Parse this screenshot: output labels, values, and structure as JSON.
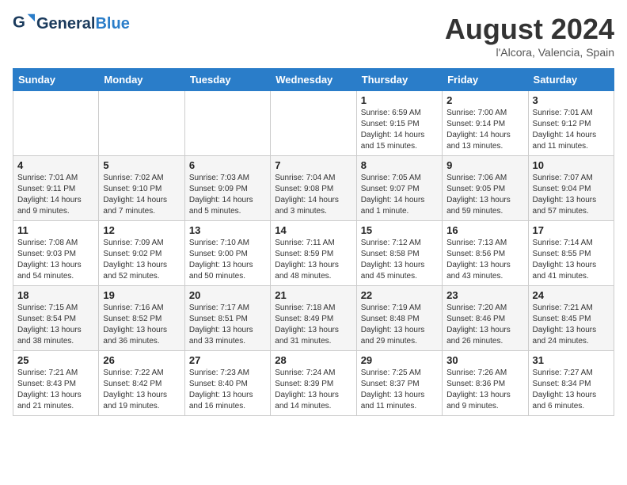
{
  "header": {
    "logo_general": "General",
    "logo_blue": "Blue",
    "month_title": "August 2024",
    "subtitle": "l'Alcora, Valencia, Spain"
  },
  "weekdays": [
    "Sunday",
    "Monday",
    "Tuesday",
    "Wednesday",
    "Thursday",
    "Friday",
    "Saturday"
  ],
  "weeks": [
    [
      {
        "day": "",
        "info": ""
      },
      {
        "day": "",
        "info": ""
      },
      {
        "day": "",
        "info": ""
      },
      {
        "day": "",
        "info": ""
      },
      {
        "day": "1",
        "info": "Sunrise: 6:59 AM\nSunset: 9:15 PM\nDaylight: 14 hours\nand 15 minutes."
      },
      {
        "day": "2",
        "info": "Sunrise: 7:00 AM\nSunset: 9:14 PM\nDaylight: 14 hours\nand 13 minutes."
      },
      {
        "day": "3",
        "info": "Sunrise: 7:01 AM\nSunset: 9:12 PM\nDaylight: 14 hours\nand 11 minutes."
      }
    ],
    [
      {
        "day": "4",
        "info": "Sunrise: 7:01 AM\nSunset: 9:11 PM\nDaylight: 14 hours\nand 9 minutes."
      },
      {
        "day": "5",
        "info": "Sunrise: 7:02 AM\nSunset: 9:10 PM\nDaylight: 14 hours\nand 7 minutes."
      },
      {
        "day": "6",
        "info": "Sunrise: 7:03 AM\nSunset: 9:09 PM\nDaylight: 14 hours\nand 5 minutes."
      },
      {
        "day": "7",
        "info": "Sunrise: 7:04 AM\nSunset: 9:08 PM\nDaylight: 14 hours\nand 3 minutes."
      },
      {
        "day": "8",
        "info": "Sunrise: 7:05 AM\nSunset: 9:07 PM\nDaylight: 14 hours\nand 1 minute."
      },
      {
        "day": "9",
        "info": "Sunrise: 7:06 AM\nSunset: 9:05 PM\nDaylight: 13 hours\nand 59 minutes."
      },
      {
        "day": "10",
        "info": "Sunrise: 7:07 AM\nSunset: 9:04 PM\nDaylight: 13 hours\nand 57 minutes."
      }
    ],
    [
      {
        "day": "11",
        "info": "Sunrise: 7:08 AM\nSunset: 9:03 PM\nDaylight: 13 hours\nand 54 minutes."
      },
      {
        "day": "12",
        "info": "Sunrise: 7:09 AM\nSunset: 9:02 PM\nDaylight: 13 hours\nand 52 minutes."
      },
      {
        "day": "13",
        "info": "Sunrise: 7:10 AM\nSunset: 9:00 PM\nDaylight: 13 hours\nand 50 minutes."
      },
      {
        "day": "14",
        "info": "Sunrise: 7:11 AM\nSunset: 8:59 PM\nDaylight: 13 hours\nand 48 minutes."
      },
      {
        "day": "15",
        "info": "Sunrise: 7:12 AM\nSunset: 8:58 PM\nDaylight: 13 hours\nand 45 minutes."
      },
      {
        "day": "16",
        "info": "Sunrise: 7:13 AM\nSunset: 8:56 PM\nDaylight: 13 hours\nand 43 minutes."
      },
      {
        "day": "17",
        "info": "Sunrise: 7:14 AM\nSunset: 8:55 PM\nDaylight: 13 hours\nand 41 minutes."
      }
    ],
    [
      {
        "day": "18",
        "info": "Sunrise: 7:15 AM\nSunset: 8:54 PM\nDaylight: 13 hours\nand 38 minutes."
      },
      {
        "day": "19",
        "info": "Sunrise: 7:16 AM\nSunset: 8:52 PM\nDaylight: 13 hours\nand 36 minutes."
      },
      {
        "day": "20",
        "info": "Sunrise: 7:17 AM\nSunset: 8:51 PM\nDaylight: 13 hours\nand 33 minutes."
      },
      {
        "day": "21",
        "info": "Sunrise: 7:18 AM\nSunset: 8:49 PM\nDaylight: 13 hours\nand 31 minutes."
      },
      {
        "day": "22",
        "info": "Sunrise: 7:19 AM\nSunset: 8:48 PM\nDaylight: 13 hours\nand 29 minutes."
      },
      {
        "day": "23",
        "info": "Sunrise: 7:20 AM\nSunset: 8:46 PM\nDaylight: 13 hours\nand 26 minutes."
      },
      {
        "day": "24",
        "info": "Sunrise: 7:21 AM\nSunset: 8:45 PM\nDaylight: 13 hours\nand 24 minutes."
      }
    ],
    [
      {
        "day": "25",
        "info": "Sunrise: 7:21 AM\nSunset: 8:43 PM\nDaylight: 13 hours\nand 21 minutes."
      },
      {
        "day": "26",
        "info": "Sunrise: 7:22 AM\nSunset: 8:42 PM\nDaylight: 13 hours\nand 19 minutes."
      },
      {
        "day": "27",
        "info": "Sunrise: 7:23 AM\nSunset: 8:40 PM\nDaylight: 13 hours\nand 16 minutes."
      },
      {
        "day": "28",
        "info": "Sunrise: 7:24 AM\nSunset: 8:39 PM\nDaylight: 13 hours\nand 14 minutes."
      },
      {
        "day": "29",
        "info": "Sunrise: 7:25 AM\nSunset: 8:37 PM\nDaylight: 13 hours\nand 11 minutes."
      },
      {
        "day": "30",
        "info": "Sunrise: 7:26 AM\nSunset: 8:36 PM\nDaylight: 13 hours\nand 9 minutes."
      },
      {
        "day": "31",
        "info": "Sunrise: 7:27 AM\nSunset: 8:34 PM\nDaylight: 13 hours\nand 6 minutes."
      }
    ]
  ]
}
